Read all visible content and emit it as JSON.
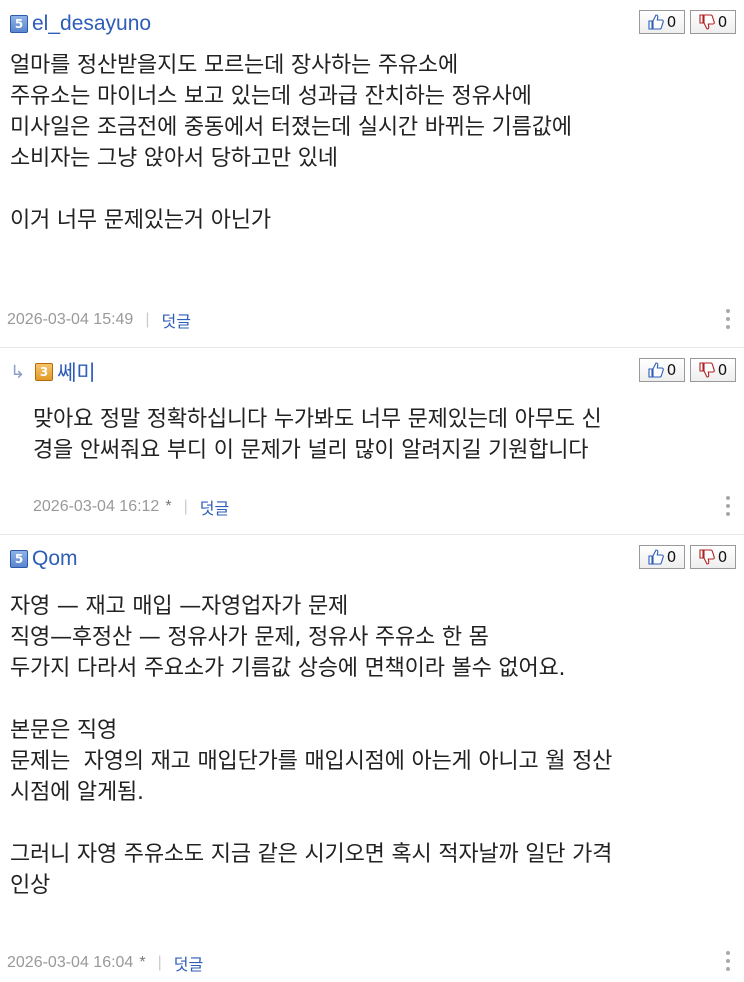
{
  "comments": [
    {
      "level": "5",
      "nick": "el_desayuno",
      "up": "0",
      "down": "0",
      "text": "얼마를 정산받을지도 모르는데 장사하는 주유소에\n주유소는 마이너스 보고 있는데 성과급 잔치하는 정유사에\n미사일은 조금전에 중동에서 터졌는데 실시간 바뀌는 기름값에\n소비자는 그냥 앉아서 당하고만 있네\n\n이거 너무 문제있는거 아닌가",
      "date": "2026-03-04 15:49",
      "reply_label": "덧글"
    },
    {
      "level": "3",
      "nick": "쎄미",
      "up": "0",
      "down": "0",
      "text": "맞아요 정말 정확하십니다 누가봐도 너무 문제있는데 아무도 신\n경을 안써줘요 부디 이 문제가 널리 많이 알려지길 기원합니다",
      "date": "2026-03-04 16:12",
      "edited": "*",
      "reply_label": "덧글"
    },
    {
      "level": "5",
      "nick": "Qom",
      "up": "0",
      "down": "0",
      "text": "자영 — 재고 매입 —자영업자가 문제\n직영—후정산 — 정유사가 문제, 정유사 주유소 한 몸\n두가지 다라서 주요소가 기름값 상승에 면책이라 볼수 없어요.\n\n본문은 직영\n문제는  자영의 재고 매입단가를 매입시점에 아는게 아니고 월 정산\n시점에 알게됨.\n\n그러니 자영 주유소도 지금 같은 시기오면 혹시 적자날까 일단 가격\n인상",
      "date": "2026-03-04 16:04",
      "edited": "*",
      "reply_label": "덧글"
    }
  ],
  "icons": {
    "like": "thumbs-up-icon",
    "dislike": "thumbs-down-icon",
    "reply_arrow": "reply-arrow-icon",
    "more": "more-options-icon"
  },
  "colors": {
    "nick": "#2e5db8",
    "meta": "#999999",
    "divider": "#e6e6e6"
  }
}
